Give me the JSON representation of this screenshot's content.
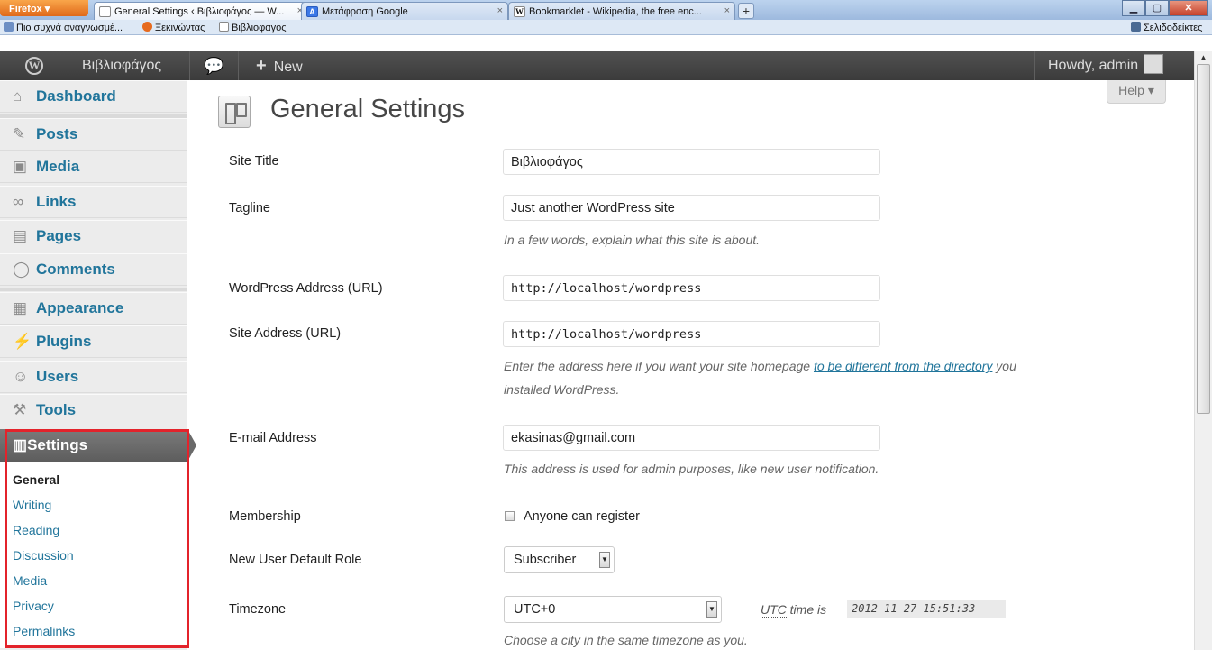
{
  "browser": {
    "app_button": "Firefox ▾",
    "tabs": [
      {
        "label": "General Settings ‹ Βιβλιοφάγος — W...",
        "icon": "page-icon",
        "active": true
      },
      {
        "label": "Μετάφραση Google",
        "icon": "google-translate-icon",
        "active": false
      },
      {
        "label": "Bookmarklet - Wikipedia, the free enc...",
        "icon": "wikipedia-icon",
        "active": false
      }
    ],
    "tab_close": "×",
    "new_tab": "+",
    "bookmarks": [
      "Πιο συχνά αναγνωσμέ...",
      "Ξεκινώντας",
      "Βιβλιοφαγος"
    ],
    "bookmarks_menu": "Σελιδοδείκτες"
  },
  "adminbar": {
    "site_name": "Βιβλιοφάγος",
    "new_label": "New",
    "howdy": "Howdy, admin"
  },
  "sidebar": {
    "items": [
      {
        "label": "Dashboard",
        "icon": "home-icon"
      },
      {
        "label": "Posts",
        "icon": "pin-icon"
      },
      {
        "label": "Media",
        "icon": "media-icon"
      },
      {
        "label": "Links",
        "icon": "link-icon"
      },
      {
        "label": "Pages",
        "icon": "pages-icon"
      },
      {
        "label": "Comments",
        "icon": "comment-icon"
      },
      {
        "label": "Appearance",
        "icon": "appearance-icon"
      },
      {
        "label": "Plugins",
        "icon": "plugin-icon"
      },
      {
        "label": "Users",
        "icon": "users-icon"
      },
      {
        "label": "Tools",
        "icon": "tools-icon"
      }
    ],
    "settings": {
      "label": "Settings",
      "submenu": [
        "General",
        "Writing",
        "Reading",
        "Discussion",
        "Media",
        "Privacy",
        "Permalinks"
      ],
      "current": "General"
    }
  },
  "main": {
    "title": "General Settings",
    "help": "Help ▾",
    "fields": {
      "site_title": {
        "label": "Site Title",
        "value": "Βιβλιοφάγος"
      },
      "tagline": {
        "label": "Tagline",
        "value": "Just another WordPress site",
        "description": "In a few words, explain what this site is about."
      },
      "wp_address": {
        "label": "WordPress Address (URL)",
        "value": "http://localhost/wordpress"
      },
      "site_address": {
        "label": "Site Address (URL)",
        "value": "http://localhost/wordpress",
        "description_before": "Enter the address here if you want your site homepage ",
        "description_link": "to be different from the directory",
        "description_after": " you",
        "description_line2": "installed WordPress."
      },
      "email": {
        "label": "E-mail Address",
        "value": "ekasinas@gmail.com",
        "description": "This address is used for admin purposes, like new user notification."
      },
      "membership": {
        "label": "Membership",
        "checkbox_label": "Anyone can register"
      },
      "default_role": {
        "label": "New User Default Role",
        "value": "Subscriber"
      },
      "timezone": {
        "label": "Timezone",
        "value": "UTC+0",
        "utc_abbr": "UTC",
        "utc_text": " time is",
        "utc_time": "2012-11-27 15:51:33",
        "description": "Choose a city in the same timezone as you."
      }
    }
  },
  "colors": {
    "link": "#21759b",
    "adminbar": "#464646",
    "highlight_box": "#e3232b"
  }
}
